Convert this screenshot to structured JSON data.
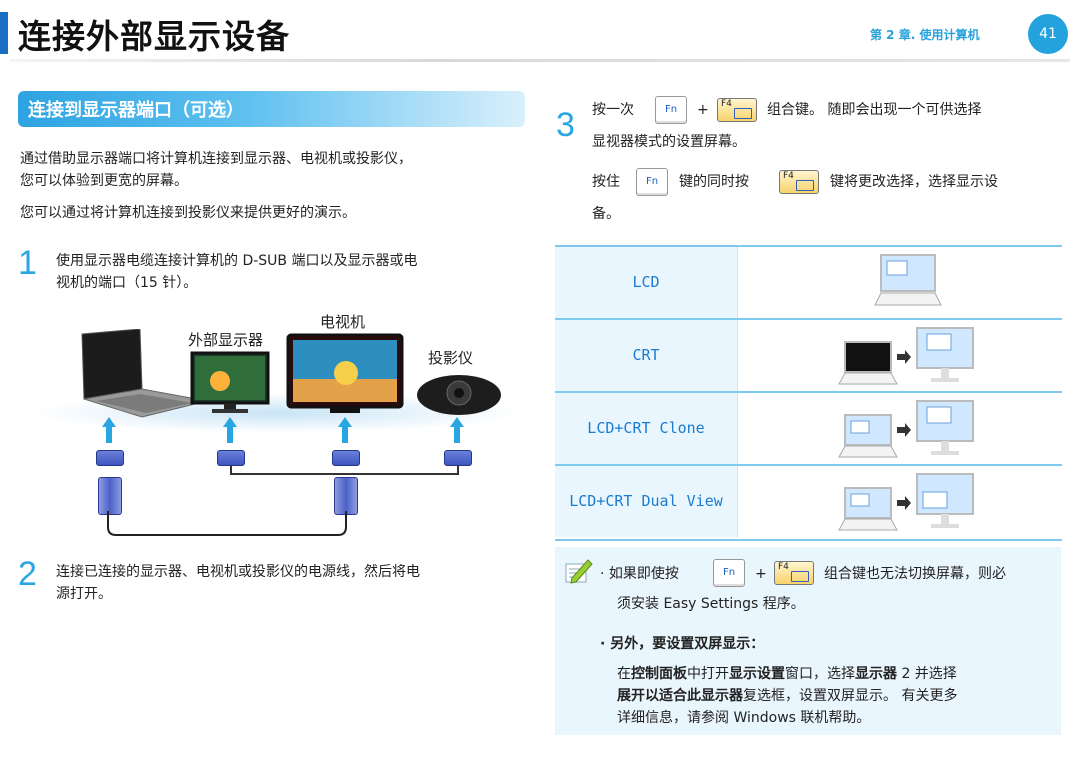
{
  "header": {
    "title": "连接外部显示设备",
    "chapter": "第 2 章. 使用计算机",
    "page_number": "41"
  },
  "section": {
    "title": "连接到显示器端口（可选）",
    "intro_line1": "通过借助显示器端口将计算机连接到显示器、电视机或投影仪，",
    "intro_line2": "您可以体验到更宽的屏幕。",
    "intro_line3": "您可以通过将计算机连接到投影仪来提供更好的演示。"
  },
  "step1": {
    "num": "1",
    "line1": "使用显示器电缆连接计算机的 D-SUB 端口以及显示器或电",
    "line2": "视机的端口（15 针）。"
  },
  "devices": {
    "tv": "电视机",
    "monitor": "外部显示器",
    "projector": "投影仪"
  },
  "step2": {
    "num": "2",
    "line1": "连接已连接的显示器、电视机或投影仪的电源线，然后将电",
    "line2": "源打开。"
  },
  "step3": {
    "num": "3",
    "a1": "按一次",
    "plus": "+",
    "a2": "组合键。 随即会出现一个可供选择",
    "a3": "显视器模式的设置屏幕。",
    "b1": "按住",
    "b2": "键的同时按",
    "b3": "键将更改选择，选择显示设",
    "b4": "备。",
    "fn": "Fn",
    "f4": "F4"
  },
  "modes": [
    {
      "label": "LCD"
    },
    {
      "label": "CRT"
    },
    {
      "label": "LCD+CRT Clone"
    },
    {
      "label": "LCD+CRT Dual View"
    }
  ],
  "note": {
    "bullet1_a": "· 如果即使按",
    "bullet1_plus": "+",
    "bullet1_b": "组合键也无法切换屏幕，则必",
    "bullet1_c": "须安装 Easy Settings 程序。",
    "bullet2_title": "· 另外，要设置双屏显示：",
    "bullet2_l1_a": "在",
    "bullet2_l1_b": "控制面板",
    "bullet2_l1_c": "中打开",
    "bullet2_l1_d": "显示设置",
    "bullet2_l1_e": "窗口，选择",
    "bullet2_l1_f": "显示器",
    "bullet2_l1_g": " 2 并选择",
    "bullet2_l2_a": "展开以适合此显示器",
    "bullet2_l2_b": "复选框，设置双屏显示。 有关更多",
    "bullet2_l3": "详细信息，请参阅 Windows 联机帮助。",
    "fn": "Fn",
    "f4": "F4"
  },
  "colors": {
    "accent": "#23a2de",
    "brand_blue": "#1b6fc2",
    "note_bg": "#eaf6fd"
  }
}
